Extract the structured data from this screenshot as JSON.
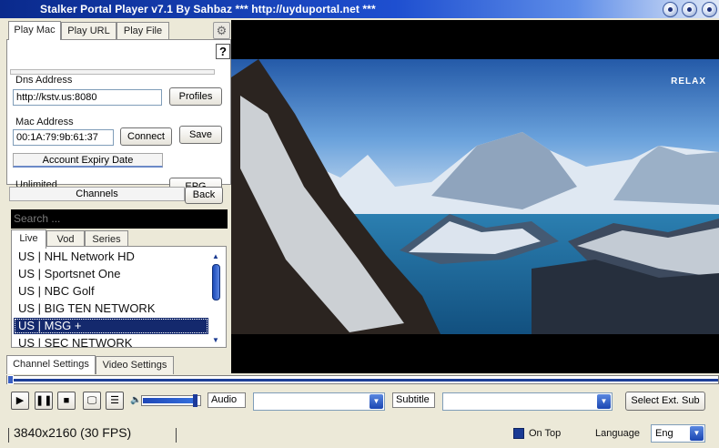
{
  "window": {
    "title": "Stalker Portal Player v7.1 By Sahbaz  *** http://uyduportal.net ***"
  },
  "tabs": [
    {
      "label": "Play Mac",
      "active": true
    },
    {
      "label": "Play URL",
      "active": false
    },
    {
      "label": "Play File",
      "active": false
    }
  ],
  "settings_icon": "gear-icon",
  "help_label": "?",
  "dns": {
    "label": "Dns Address",
    "value": "http://kstv.us:8080"
  },
  "profiles_button": "Profiles",
  "mac": {
    "label": "Mac Address",
    "value": "00:1A:79:9b:61:37"
  },
  "connect_button": "Connect",
  "save_button": "Save",
  "expiry": {
    "label": "Account Expiry Date",
    "value": "Unlimited"
  },
  "epg_button": "EPG",
  "channels": {
    "header": "Channels",
    "back_button": "Back",
    "search_placeholder": "Search ...",
    "tabs": [
      {
        "label": "Live",
        "active": true
      },
      {
        "label": "Vod",
        "active": false
      },
      {
        "label": "Series",
        "active": false
      }
    ],
    "items": [
      {
        "label": "US | NHL Network HD",
        "selected": false
      },
      {
        "label": "US | Sportsnet One",
        "selected": false
      },
      {
        "label": "US | NBC Golf",
        "selected": false
      },
      {
        "label": "US | BIG TEN NETWORK",
        "selected": false
      },
      {
        "label": "US | MSG +",
        "selected": true
      },
      {
        "label": "US | SEC NETWORK",
        "selected": false
      }
    ]
  },
  "bottom_tabs": [
    {
      "label": "Channel Settings",
      "active": true
    },
    {
      "label": "Video Settings",
      "active": false
    }
  ],
  "video": {
    "watermark": "RELAX"
  },
  "controls": {
    "audio_label": "Audio",
    "audio_value": "",
    "subtitle_label": "Subtitle",
    "subtitle_value": "",
    "select_ext_sub": "Select Ext. Sub",
    "volume_level": 0.92,
    "progress": 0.0
  },
  "status": {
    "resolution": "3840x2160  (30 FPS)",
    "on_top_label": "On Top",
    "on_top_checked": true,
    "language_label": "Language",
    "language_value": "Eng"
  },
  "colors": {
    "accent": "#14296d",
    "titlebar": "#1e4fd0",
    "background": "#ece9d8"
  }
}
